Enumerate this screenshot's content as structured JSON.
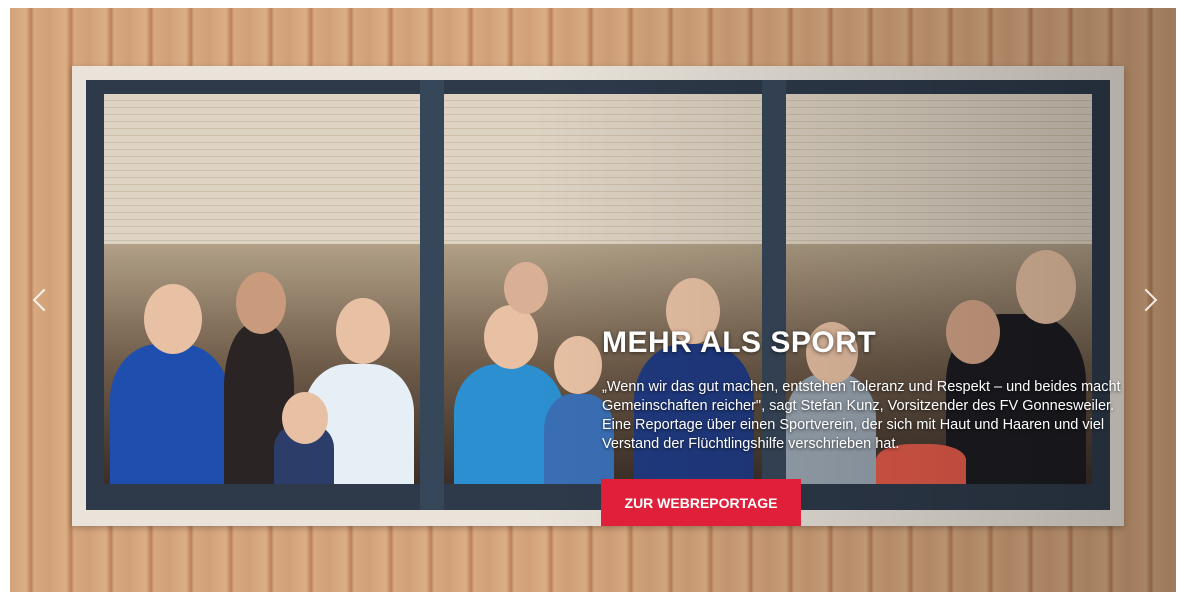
{
  "slide": {
    "title": "MEHR ALS SPORT",
    "teaser": "„Wenn wir das gut machen, entstehen Toleranz und Respekt – und beides macht Gemeinschaften reicher\", sagt Stefan Kunz, Vorsitzender des FV Gonnesweiler. Eine Reportage über einen Sportverein, der sich mit Haut und Haaren und viel Verstand der Flüchtlingshilfe verschrieben hat.",
    "cta_label": "ZUR WEBREPORTAGE"
  },
  "controls": {
    "prev_icon": "chevron-left-icon",
    "next_icon": "chevron-right-icon"
  },
  "colors": {
    "cta_background": "#e0203a",
    "text": "#ffffff",
    "window_frame": "#2e3a4a"
  }
}
